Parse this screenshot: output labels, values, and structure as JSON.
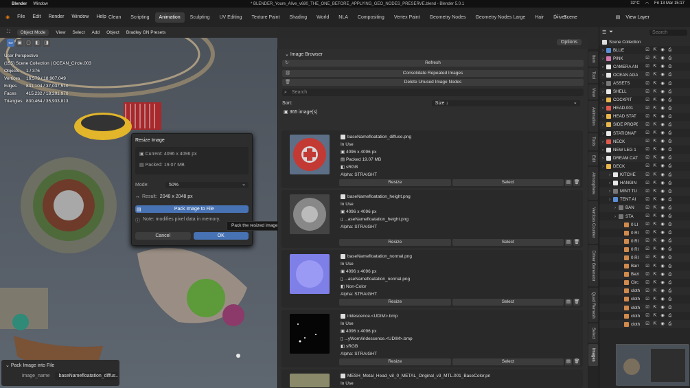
{
  "os_bar": {
    "app": "Blender",
    "window_menu": "Window",
    "title": "* BLENDER_Youre_Alive_v680_THE_ONE_BEFORE_APPLYING_GEO_NODES_PRESERVE.blend - Blender 5.0.1",
    "temp": "32°C",
    "datetime": "Fri 13 Mar 15:17"
  },
  "menu": {
    "items": [
      "File",
      "Edit",
      "Render",
      "Window",
      "Help"
    ],
    "tabs": [
      "Clean",
      "Scripting",
      "Animation",
      "Sculpting",
      "UV Editing",
      "Texture Paint",
      "Shading",
      "World",
      "NLA",
      "Compositing",
      "Vertex Paint",
      "Geometry Nodes",
      "Geometry Nodes Large",
      "Hair",
      "Driver"
    ],
    "active_tab": "Animation",
    "scene": "Scene",
    "view_layer": "View Layer"
  },
  "viewport": {
    "mode": "Object Mode",
    "menus": [
      "View",
      "Select",
      "Add",
      "Object",
      "Bradley GN Presets"
    ],
    "orientation": "Global",
    "overlay": {
      "title": "User Perspective",
      "collection": "(155) Scene Collection | OCEAN_Circle.003",
      "objects_label": "Objects",
      "objects": "1 / 376",
      "vertices_label": "Vertices",
      "vertices": "16,579 / 18,907,049",
      "edges_label": "Edges",
      "edges": "831,104 / 37,037,510",
      "faces_label": "Faces",
      "faces": "415,232 / 18,201,970",
      "triangles_label": "Triangles",
      "triangles": "830,464 / 35,933,813"
    }
  },
  "resize_dialog": {
    "title": "Resize Image",
    "current_label": "Current:",
    "current": "4096 x 4096 px",
    "packed_label": "Packed:",
    "packed": "19.07 MB",
    "mode_label": "Mode:",
    "mode": "50%",
    "result_label": "Result:",
    "result": "2048 x 2048 px",
    "pack_button": "Pack Image to File",
    "note": "Note: modifies pixel data in memory.",
    "cancel": "Cancel",
    "ok": "OK"
  },
  "tooltip": "Pack the resized image into the .blend file immediately after scaling.",
  "last_operator": {
    "title": "Pack Image into File",
    "field_label": "image_name",
    "field_value": "baseNamefloatation_diffus..."
  },
  "image_browser": {
    "title": "Image Browser",
    "options": "Options",
    "refresh": "Refresh",
    "consolidate": "Consolidate Repeated Images",
    "delete_unused": "Delete Unused Image Nodes",
    "search_placeholder": "Search",
    "sort_label": "Sort:",
    "sort_value": "Size ↓",
    "count": "365 image(s)",
    "images": [
      {
        "name": "baseNamefloatation_diffuse.png",
        "status": "In Use",
        "size": "4096 x 4096 px",
        "source": "Packed  19.07 MB",
        "colorspace": "sRGB",
        "alpha": "Alpha: STRAIGHT",
        "resize": "Resize",
        "select": "Select",
        "thumb_color": "#c33a35"
      },
      {
        "name": "baseNamefloatation_height.png",
        "status": "In Use",
        "size": "4096 x 4096 px",
        "source": "...aseNamefloatation_height.png",
        "colorspace": "",
        "alpha": "Alpha: STRAIGHT",
        "resize": "Resize",
        "select": "Select",
        "thumb_color": "#777777"
      },
      {
        "name": "baseNamefloatation_normal.png",
        "status": "In Use",
        "size": "4096 x 4096 px",
        "source": "...aseNamefloatation_normal.png",
        "colorspace": "Non-Color",
        "alpha": "Alpha: STRAIGHT",
        "resize": "Resize",
        "select": "Select",
        "thumb_color": "#7f7fe8"
      },
      {
        "name": "iridescence.<UDIM>.bmp",
        "status": "In Use",
        "size": "4096 x 4096 px",
        "source": "...yWorn/iridescence.<UDIM>.bmp",
        "colorspace": "sRGB",
        "alpha": "Alpha: STRAIGHT",
        "resize": "Resize",
        "select": "Select",
        "thumb_color": "#050505"
      },
      {
        "name": "MESH_Metal_Head_v8_0_METAL_Original_v3_MTL.001_BaseColor.pn",
        "status": "In Use",
        "size": "",
        "source": "",
        "colorspace": "",
        "alpha": "",
        "resize": "",
        "select": "",
        "thumb_color": "#8a8a6a"
      }
    ]
  },
  "side_tabs": [
    "Item",
    "Tool",
    "View",
    "Animation",
    "Tools",
    "Edit",
    "Atmosphere",
    "Vertices Counter",
    "Driver Generator",
    "Quad Remesh",
    "Select",
    "Images"
  ],
  "outliner": {
    "header": "Scene Collection",
    "search_placeholder": "Search",
    "rows": [
      {
        "name": "BLUE",
        "color": "#5a8fd6"
      },
      {
        "name": "PINK",
        "color": "#d07ab0"
      },
      {
        "name": "CAMERA AN",
        "color": "#e8e8e8"
      },
      {
        "name": "OCEAN AGA",
        "color": "#e8e8e8"
      },
      {
        "name": "ASSETS",
        "color": "#777777"
      },
      {
        "name": "SHELL",
        "color": "#e8e8e8"
      },
      {
        "name": "COCKPIT",
        "color": "#e8b64d"
      },
      {
        "name": "HEAD.001",
        "color": "#e05a4d"
      },
      {
        "name": "HEAD STAT",
        "color": "#e8b64d"
      },
      {
        "name": "SIDE PROPE",
        "color": "#e8b64d"
      },
      {
        "name": "STATIONAF",
        "color": "#e8e8e8"
      },
      {
        "name": "NECK",
        "color": "#e05a4d"
      },
      {
        "name": "NEW LEG 1",
        "color": "#e8e8e8"
      },
      {
        "name": "DREAM CAT",
        "color": "#e8e8e8"
      },
      {
        "name": "DECK",
        "color": "#e8b64d"
      },
      {
        "name": "KITCHE",
        "color": "#e8e8e8"
      },
      {
        "name": "HANGIN",
        "color": "#e8e8e8"
      },
      {
        "name": "MINT TU",
        "color": "#777777"
      },
      {
        "name": "TENT AI",
        "color": "#5a8fd6"
      },
      {
        "name": "BAN",
        "color": "#777777"
      },
      {
        "name": "STA",
        "color": "#777777"
      },
      {
        "name": "0 LI",
        "color": "#d08a4d"
      },
      {
        "name": "0 RI",
        "color": "#d08a4d"
      },
      {
        "name": "0 RI",
        "color": "#d08a4d"
      },
      {
        "name": "0 RI",
        "color": "#d08a4d"
      },
      {
        "name": "0 RI",
        "color": "#d08a4d"
      },
      {
        "name": "Barr",
        "color": "#d08a4d"
      },
      {
        "name": "Bezi",
        "color": "#d08a4d"
      },
      {
        "name": "Circ",
        "color": "#d08a4d"
      },
      {
        "name": "cloth",
        "color": "#d08a4d"
      },
      {
        "name": "cloth",
        "color": "#d08a4d"
      },
      {
        "name": "cloth",
        "color": "#d08a4d"
      },
      {
        "name": "cloth",
        "color": "#d08a4d"
      },
      {
        "name": "cloth",
        "color": "#d08a4d"
      }
    ]
  }
}
